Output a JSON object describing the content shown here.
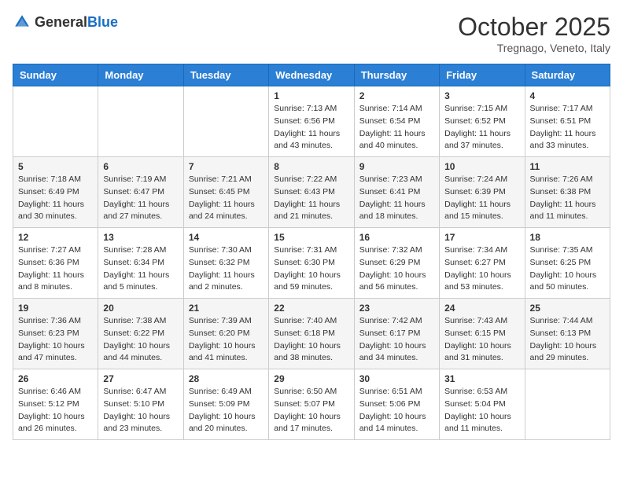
{
  "header": {
    "logo_general": "General",
    "logo_blue": "Blue",
    "month_title": "October 2025",
    "location": "Tregnago, Veneto, Italy"
  },
  "days_of_week": [
    "Sunday",
    "Monday",
    "Tuesday",
    "Wednesday",
    "Thursday",
    "Friday",
    "Saturday"
  ],
  "weeks": [
    [
      null,
      null,
      null,
      {
        "day": "1",
        "sunrise": "7:13 AM",
        "sunset": "6:56 PM",
        "daylight": "11 hours and 43 minutes."
      },
      {
        "day": "2",
        "sunrise": "7:14 AM",
        "sunset": "6:54 PM",
        "daylight": "11 hours and 40 minutes."
      },
      {
        "day": "3",
        "sunrise": "7:15 AM",
        "sunset": "6:52 PM",
        "daylight": "11 hours and 37 minutes."
      },
      {
        "day": "4",
        "sunrise": "7:17 AM",
        "sunset": "6:51 PM",
        "daylight": "11 hours and 33 minutes."
      }
    ],
    [
      {
        "day": "5",
        "sunrise": "7:18 AM",
        "sunset": "6:49 PM",
        "daylight": "11 hours and 30 minutes."
      },
      {
        "day": "6",
        "sunrise": "7:19 AM",
        "sunset": "6:47 PM",
        "daylight": "11 hours and 27 minutes."
      },
      {
        "day": "7",
        "sunrise": "7:21 AM",
        "sunset": "6:45 PM",
        "daylight": "11 hours and 24 minutes."
      },
      {
        "day": "8",
        "sunrise": "7:22 AM",
        "sunset": "6:43 PM",
        "daylight": "11 hours and 21 minutes."
      },
      {
        "day": "9",
        "sunrise": "7:23 AM",
        "sunset": "6:41 PM",
        "daylight": "11 hours and 18 minutes."
      },
      {
        "day": "10",
        "sunrise": "7:24 AM",
        "sunset": "6:39 PM",
        "daylight": "11 hours and 15 minutes."
      },
      {
        "day": "11",
        "sunrise": "7:26 AM",
        "sunset": "6:38 PM",
        "daylight": "11 hours and 11 minutes."
      }
    ],
    [
      {
        "day": "12",
        "sunrise": "7:27 AM",
        "sunset": "6:36 PM",
        "daylight": "11 hours and 8 minutes."
      },
      {
        "day": "13",
        "sunrise": "7:28 AM",
        "sunset": "6:34 PM",
        "daylight": "11 hours and 5 minutes."
      },
      {
        "day": "14",
        "sunrise": "7:30 AM",
        "sunset": "6:32 PM",
        "daylight": "11 hours and 2 minutes."
      },
      {
        "day": "15",
        "sunrise": "7:31 AM",
        "sunset": "6:30 PM",
        "daylight": "10 hours and 59 minutes."
      },
      {
        "day": "16",
        "sunrise": "7:32 AM",
        "sunset": "6:29 PM",
        "daylight": "10 hours and 56 minutes."
      },
      {
        "day": "17",
        "sunrise": "7:34 AM",
        "sunset": "6:27 PM",
        "daylight": "10 hours and 53 minutes."
      },
      {
        "day": "18",
        "sunrise": "7:35 AM",
        "sunset": "6:25 PM",
        "daylight": "10 hours and 50 minutes."
      }
    ],
    [
      {
        "day": "19",
        "sunrise": "7:36 AM",
        "sunset": "6:23 PM",
        "daylight": "10 hours and 47 minutes."
      },
      {
        "day": "20",
        "sunrise": "7:38 AM",
        "sunset": "6:22 PM",
        "daylight": "10 hours and 44 minutes."
      },
      {
        "day": "21",
        "sunrise": "7:39 AM",
        "sunset": "6:20 PM",
        "daylight": "10 hours and 41 minutes."
      },
      {
        "day": "22",
        "sunrise": "7:40 AM",
        "sunset": "6:18 PM",
        "daylight": "10 hours and 38 minutes."
      },
      {
        "day": "23",
        "sunrise": "7:42 AM",
        "sunset": "6:17 PM",
        "daylight": "10 hours and 34 minutes."
      },
      {
        "day": "24",
        "sunrise": "7:43 AM",
        "sunset": "6:15 PM",
        "daylight": "10 hours and 31 minutes."
      },
      {
        "day": "25",
        "sunrise": "7:44 AM",
        "sunset": "6:13 PM",
        "daylight": "10 hours and 29 minutes."
      }
    ],
    [
      {
        "day": "26",
        "sunrise": "6:46 AM",
        "sunset": "5:12 PM",
        "daylight": "10 hours and 26 minutes."
      },
      {
        "day": "27",
        "sunrise": "6:47 AM",
        "sunset": "5:10 PM",
        "daylight": "10 hours and 23 minutes."
      },
      {
        "day": "28",
        "sunrise": "6:49 AM",
        "sunset": "5:09 PM",
        "daylight": "10 hours and 20 minutes."
      },
      {
        "day": "29",
        "sunrise": "6:50 AM",
        "sunset": "5:07 PM",
        "daylight": "10 hours and 17 minutes."
      },
      {
        "day": "30",
        "sunrise": "6:51 AM",
        "sunset": "5:06 PM",
        "daylight": "10 hours and 14 minutes."
      },
      {
        "day": "31",
        "sunrise": "6:53 AM",
        "sunset": "5:04 PM",
        "daylight": "10 hours and 11 minutes."
      },
      null
    ]
  ],
  "labels": {
    "sunrise": "Sunrise:",
    "sunset": "Sunset:",
    "daylight": "Daylight:"
  }
}
